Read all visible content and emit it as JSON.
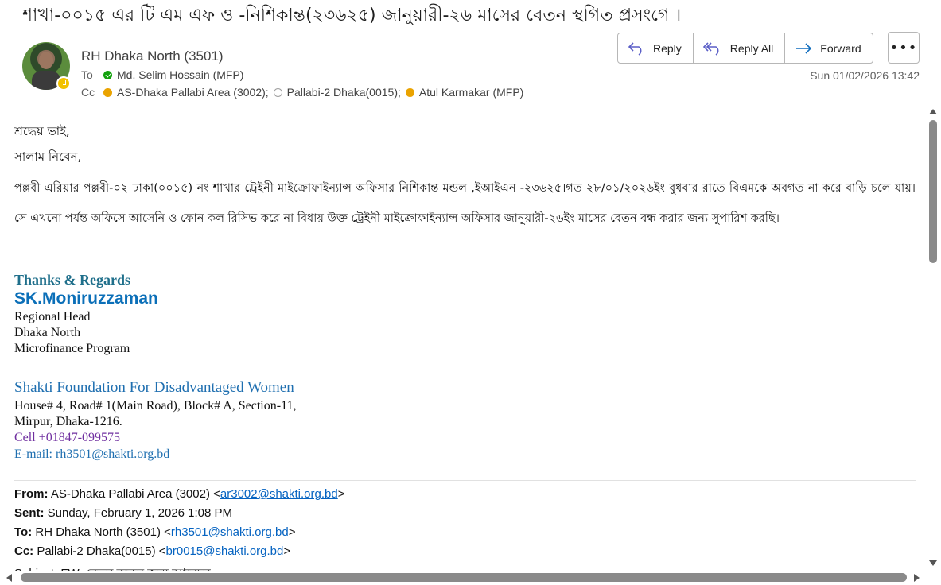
{
  "email": {
    "subject": "শাখা-০০১৫ এর টি এম এফ ও -নিশিকান্ত(২৩৬২৫)  জানুয়ারী-২৬ মাসের  বেতন স্থগিত প্রসংগে ।",
    "sender": "RH  Dhaka North (3501)",
    "to_label": "To",
    "to": "Md. Selim Hossain (MFP)",
    "cc_label": "Cc",
    "cc": [
      "AS-Dhaka  Pallabi Area (3002);",
      "Pallabi-2 Dhaka(0015);",
      "Atul  Karmakar (MFP)"
    ],
    "timestamp": "Sun 01/02/2026 13:42"
  },
  "actions": {
    "reply": "Reply",
    "reply_all": "Reply All",
    "forward": "Forward",
    "more": "•••"
  },
  "body": {
    "greeting1": "শ্রদ্ধেয় ভাই,",
    "greeting2": "সালাম নিবেন,",
    "paragraph": "পল্লবী এরিয়ার  পল্লবী-০২ ঢাকা(০০১৫) নং শাখার ট্রেইনী মাইক্রোফাইন্যান্স অফিসার নিশিকান্ত মন্ডল ,ইআইএন -২৩৬২৫।গত ২৮/০১/২০২৬ইং বুধবার রাতে বিএমকে অবগত  না করে  বাড়ি চলে যায়।সে এখনো পর্যন্ত অফিসে আসেনি ও ফোন কল রিসিভ করে না বিধায় উক্ত ট্রেইনী মাইক্রোফাইন্যান্স অফিসার জানুয়ারী-২৬ইং মাসের বেতন বন্ধ করার জন্য সুপারিশ করছি।"
  },
  "signature": {
    "thanks": "Thanks & Regards",
    "name": "SK.Moniruzzaman",
    "title": "Regional Head",
    "region": "Dhaka North",
    "program": "Microfinance Program",
    "org": "Shakti Foundation For Disadvantaged Women",
    "address1": "House# 4, Road# 1(Main Road), Block# A, Section-11,",
    "address2": "Mirpur, Dhaka-1216.",
    "cell": "Cell +01847-099575",
    "email_label": "E-mail:",
    "email": "rh3501@shakti.org.bd"
  },
  "forwarded": {
    "from_label": "From:",
    "from_name": "AS-Dhaka Pallabi Area (3002) <",
    "from_email": "ar3002@shakti.org.bd",
    "sent_label": "Sent:",
    "sent": "Sunday, February 1, 2026 1:08 PM",
    "to_label": "To:",
    "to_name": "RH Dhaka North (3501) <",
    "to_email": "rh3501@shakti.org.bd",
    "cc_label": "Cc:",
    "cc_name": "Pallabi-2 Dhaka(0015) <",
    "cc_email": "br0015@shakti.org.bd",
    "close": ">",
    "subject_partial": "Subject: FW: বেতন বন্ধের জন্য আবেদন"
  }
}
